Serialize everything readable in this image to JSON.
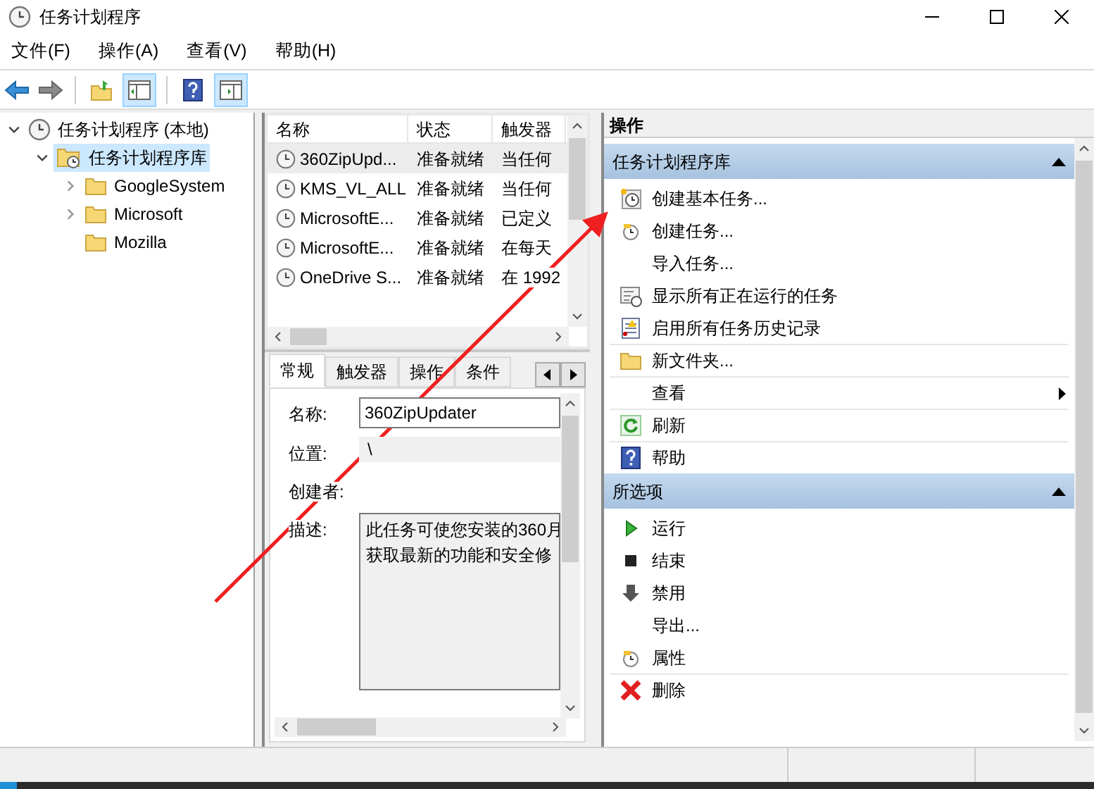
{
  "window": {
    "title": "任务计划程序"
  },
  "menu": [
    "文件(F)",
    "操作(A)",
    "查看(V)",
    "帮助(H)"
  ],
  "tree": [
    {
      "label": "任务计划程序 (本地)",
      "selected": false,
      "expanded": true,
      "children": [
        {
          "label": "任务计划程序库",
          "selected": true,
          "expanded": true,
          "children": [
            {
              "label": "GoogleSystem",
              "selected": false,
              "has_children": true
            },
            {
              "label": "Microsoft",
              "selected": false,
              "has_children": true
            },
            {
              "label": "Mozilla",
              "selected": false,
              "has_children": false
            }
          ]
        }
      ]
    }
  ],
  "task_list": {
    "columns": [
      "名称",
      "状态",
      "触发器"
    ],
    "rows": [
      {
        "name": "360ZipUpd...",
        "status": "准备就绪",
        "trigger": "当任何",
        "selected": true
      },
      {
        "name": "KMS_VL_ALL",
        "status": "准备就绪",
        "trigger": "当任何",
        "selected": false
      },
      {
        "name": "MicrosoftE...",
        "status": "准备就绪",
        "trigger": "已定义",
        "selected": false
      },
      {
        "name": "MicrosoftE...",
        "status": "准备就绪",
        "trigger": "在每天",
        "selected": false
      },
      {
        "name": "OneDrive S...",
        "status": "准备就绪",
        "trigger": "在 1992",
        "selected": false
      }
    ]
  },
  "details": {
    "tabs": [
      {
        "label": "常规",
        "selected": true
      },
      {
        "label": "触发器",
        "selected": false
      },
      {
        "label": "操作",
        "selected": false
      },
      {
        "label": "条件",
        "selected": false
      }
    ],
    "fields": [
      {
        "label": "名称:",
        "kind": "input",
        "value": "360ZipUpdater"
      },
      {
        "label": "位置:",
        "kind": "readonly",
        "value": "\\"
      },
      {
        "label": "创建者:",
        "kind": "empty"
      },
      {
        "label": "描述:",
        "kind": "textarea",
        "lines": [
          "此任务可使您安装的360月",
          "获取最新的功能和安全修"
        ]
      }
    ]
  },
  "actions": {
    "title": "操作",
    "sections": [
      {
        "title": "任务计划程序库",
        "expanded": true,
        "items": [
          {
            "label": "创建基本任务...",
            "kind": "clock-star",
            "divider": false,
            "submenu": false
          },
          {
            "label": "创建任务...",
            "kind": "clock-small",
            "divider": false,
            "submenu": false
          },
          {
            "label": "导入任务...",
            "kind": "plain",
            "divider": false,
            "submenu": false
          },
          {
            "label": "显示所有正在运行的任务",
            "kind": "list-clock",
            "divider": false,
            "submenu": false
          },
          {
            "label": "启用所有任务历史记录",
            "kind": "log",
            "divider": false,
            "submenu": false
          },
          {
            "label": "新文件夹...",
            "kind": "folder",
            "divider": true,
            "submenu": false
          },
          {
            "label": "查看",
            "kind": "plain",
            "divider": true,
            "submenu": true
          },
          {
            "label": "刷新",
            "kind": "refresh",
            "divider": true,
            "submenu": false
          },
          {
            "label": "帮助",
            "kind": "help",
            "divider": true,
            "submenu": false
          }
        ]
      },
      {
        "title": "所选项",
        "expanded": true,
        "items": [
          {
            "label": "运行",
            "kind": "run",
            "divider": false,
            "submenu": false
          },
          {
            "label": "结束",
            "kind": "stop",
            "divider": false,
            "submenu": false
          },
          {
            "label": "禁用",
            "kind": "disable",
            "divider": false,
            "submenu": false
          },
          {
            "label": "导出...",
            "kind": "plain",
            "divider": false,
            "submenu": false
          },
          {
            "label": "属性",
            "kind": "clock-small",
            "divider": false,
            "submenu": false
          },
          {
            "label": "删除",
            "kind": "delete",
            "divider": true,
            "submenu": false
          }
        ]
      }
    ]
  }
}
